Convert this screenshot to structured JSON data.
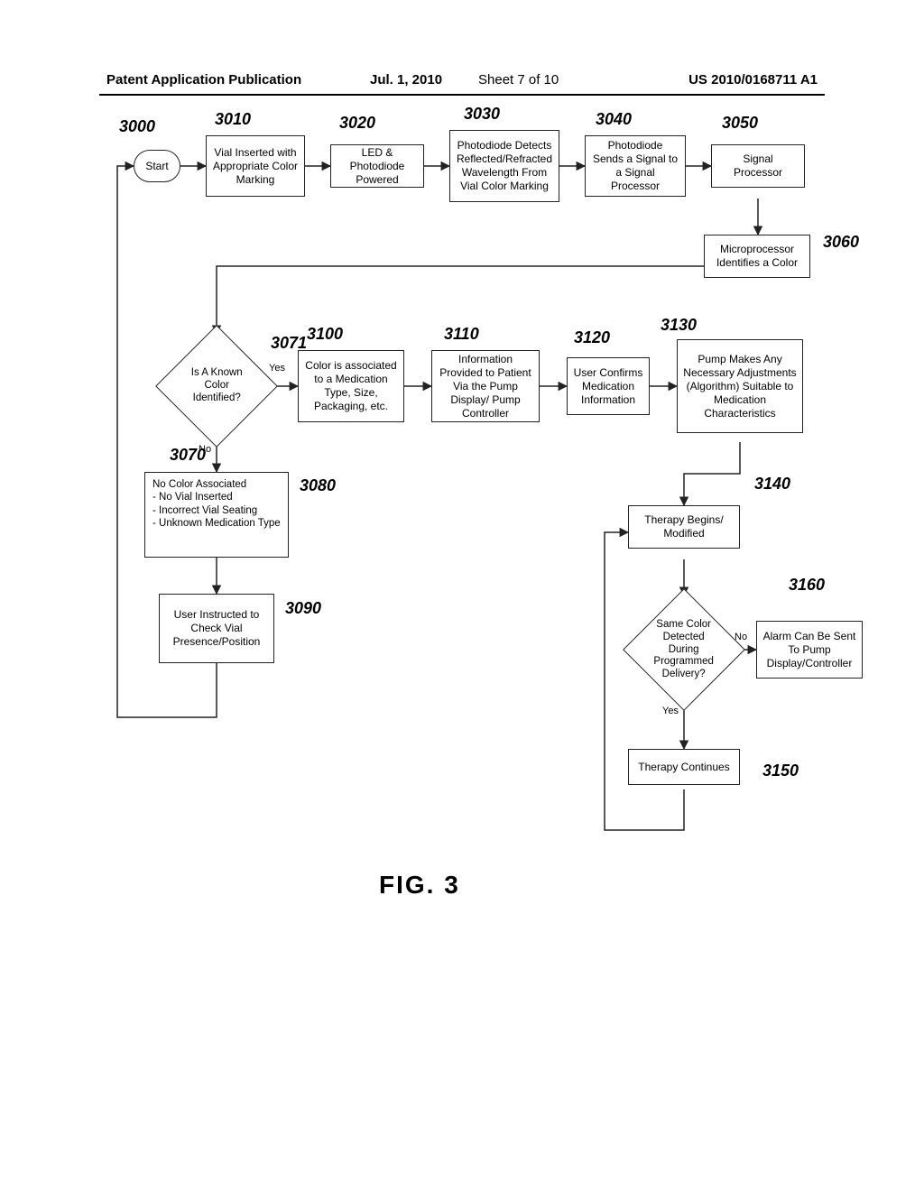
{
  "header": {
    "left": "Patent Application Publication",
    "date": "Jul. 1, 2010",
    "sheet": "Sheet 7 of 10",
    "pubno": "US 2010/0168711 A1"
  },
  "boxes": {
    "b3000": "Start",
    "b3010": "Vial Inserted with Appropriate Color Marking",
    "b3020": "LED & Photodiode Powered",
    "b3030": "Photodiode Detects Reflected/Refracted Wavelength From Vial Color Marking",
    "b3040": "Photodiode Sends a Signal to a Signal Processor",
    "b3050": "Signal Processor",
    "b3060": "Microprocessor Identifies a Color",
    "b3070": "Is A Known Color Identified?",
    "b3080_l1": "No Color Associated",
    "b3080_l2": "- No Vial Inserted",
    "b3080_l3": "- Incorrect Vial Seating",
    "b3080_l4": "- Unknown Medication Type",
    "b3090": "User Instructed to Check Vial Presence/Position",
    "b3100": "Color is associated to a Medication Type, Size, Packaging, etc.",
    "b3110": "Information Provided to Patient Via the Pump Display/ Pump Controller",
    "b3120": "User Confirms Medication Information",
    "b3130": "Pump Makes Any Necessary Adjustments (Algorithm) Suitable to Medication Characteristics",
    "b3140": "Therapy Begins/ Modified",
    "b3150": "Therapy Continues",
    "b3160": "Alarm Can Be Sent To Pump Display/Controller",
    "bDelivery": "Same Color Detected During Programmed Delivery?"
  },
  "labels": {
    "r3000": "3000",
    "r3010": "3010",
    "r3020": "3020",
    "r3030": "3030",
    "r3040": "3040",
    "r3050": "3050",
    "r3060": "3060",
    "r3070": "3070",
    "r3071": "3071",
    "r3080": "3080",
    "r3090": "3090",
    "r3100": "3100",
    "r3110": "3110",
    "r3120": "3120",
    "r3130": "3130",
    "r3140": "3140",
    "r3150": "3150",
    "r3160": "3160",
    "yes": "Yes",
    "no": "No",
    "fig": "FIG. 3"
  },
  "chart_data": {
    "type": "diagram",
    "figure": "FIG. 3",
    "nodes": [
      {
        "id": "3000",
        "label": "Start",
        "shape": "rounded"
      },
      {
        "id": "3010",
        "label": "Vial Inserted with Appropriate Color Marking",
        "shape": "rect"
      },
      {
        "id": "3020",
        "label": "LED & Photodiode Powered",
        "shape": "rect"
      },
      {
        "id": "3030",
        "label": "Photodiode Detects Reflected/Refracted Wavelength From Vial Color Marking",
        "shape": "rect"
      },
      {
        "id": "3040",
        "label": "Photodiode Sends a Signal to a Signal Processor",
        "shape": "rect"
      },
      {
        "id": "3050",
        "label": "Signal Processor",
        "shape": "rect"
      },
      {
        "id": "3060",
        "label": "Microprocessor Identifies a Color",
        "shape": "rect"
      },
      {
        "id": "3070",
        "label": "Is A Known Color Identified?",
        "shape": "diamond"
      },
      {
        "id": "3080",
        "label": "No Color Associated - No Vial Inserted - Incorrect Vial Seating - Unknown Medication Type",
        "shape": "rect"
      },
      {
        "id": "3090",
        "label": "User Instructed to Check Vial Presence/Position",
        "shape": "rect"
      },
      {
        "id": "3100",
        "label": "Color is associated to a Medication Type, Size, Packaging, etc.",
        "shape": "rect"
      },
      {
        "id": "3110",
        "label": "Information Provided to Patient Via the Pump Display/ Pump Controller",
        "shape": "rect"
      },
      {
        "id": "3120",
        "label": "User Confirms Medication Information",
        "shape": "rect"
      },
      {
        "id": "3130",
        "label": "Pump Makes Any Necessary Adjustments (Algorithm) Suitable to Medication Characteristics",
        "shape": "rect"
      },
      {
        "id": "3140",
        "label": "Therapy Begins/ Modified",
        "shape": "rect"
      },
      {
        "id": "Delivery",
        "label": "Same Color Detected During Programmed Delivery?",
        "shape": "diamond"
      },
      {
        "id": "3150",
        "label": "Therapy Continues",
        "shape": "rect"
      },
      {
        "id": "3160",
        "label": "Alarm Can Be Sent To Pump Display/Controller",
        "shape": "rect"
      }
    ],
    "edges": [
      {
        "from": "3000",
        "to": "3010"
      },
      {
        "from": "3010",
        "to": "3020"
      },
      {
        "from": "3020",
        "to": "3030"
      },
      {
        "from": "3030",
        "to": "3040"
      },
      {
        "from": "3040",
        "to": "3050"
      },
      {
        "from": "3050",
        "to": "3060"
      },
      {
        "from": "3060",
        "to": "3070"
      },
      {
        "from": "3070",
        "to": "3080",
        "label": "No"
      },
      {
        "from": "3070",
        "to": "3100",
        "label": "Yes",
        "ref": "3071"
      },
      {
        "from": "3080",
        "to": "3090"
      },
      {
        "from": "3090",
        "to": "3000"
      },
      {
        "from": "3100",
        "to": "3110"
      },
      {
        "from": "3110",
        "to": "3120"
      },
      {
        "from": "3120",
        "to": "3130"
      },
      {
        "from": "3130",
        "to": "3140"
      },
      {
        "from": "3140",
        "to": "Delivery"
      },
      {
        "from": "Delivery",
        "to": "3150",
        "label": "Yes"
      },
      {
        "from": "Delivery",
        "to": "3160",
        "label": "No"
      },
      {
        "from": "3150",
        "to": "3140"
      }
    ]
  }
}
